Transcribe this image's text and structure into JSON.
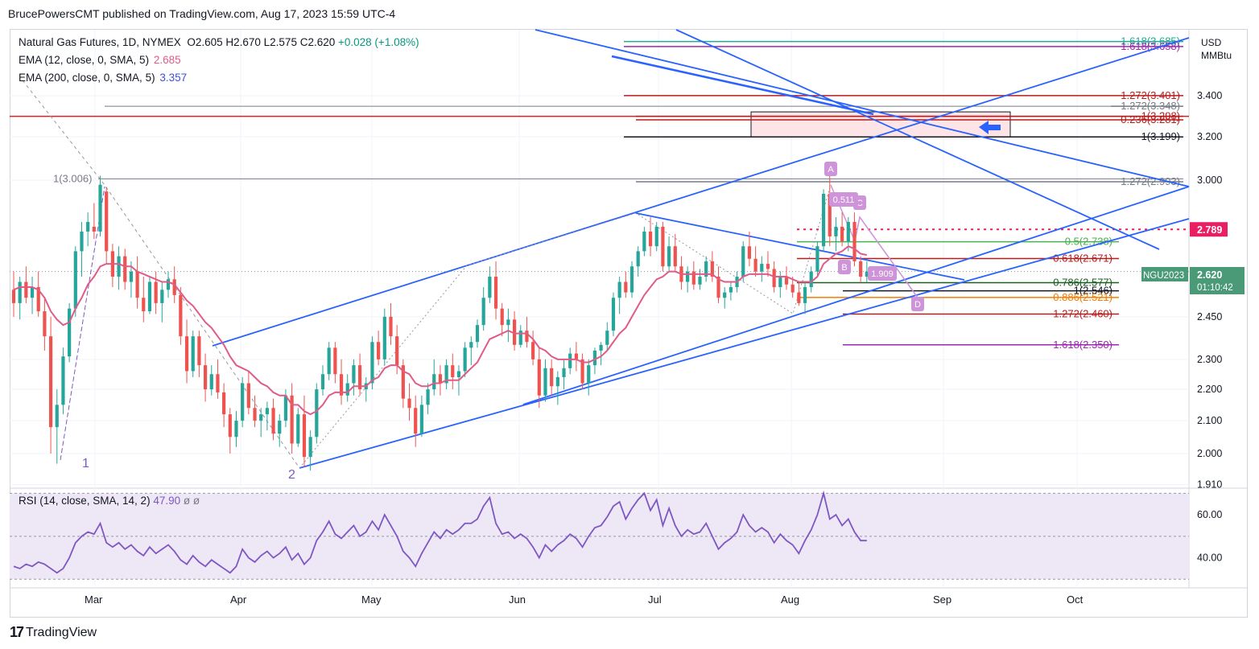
{
  "header": {
    "publisher_line": "BrucePowersCMT published on TradingView.com, Aug 17, 2023 15:59 UTC-4"
  },
  "legend": {
    "symbol": "Natural Gas Futures, 1D, NYMEX",
    "ohlc": "O2.605  H2.670  L2.575  C2.620",
    "change": "+0.028 (+1.08%)",
    "ema12_label": "EMA (12, close, 0, SMA, 5)",
    "ema12_value": "2.685",
    "ema200_label": "EMA (200, close, 0, SMA, 5)",
    "ema200_value": "3.357",
    "rsi_label": "RSI (14, close, SMA, 14, 2)",
    "rsi_value": "47.90",
    "rsi_extra": "ø  ø"
  },
  "currency": {
    "line1": "USD",
    "line2": "MMBtu"
  },
  "colors": {
    "up": "#26a69a",
    "down": "#ef5350",
    "ema12": "#e05b86",
    "ema200": "#3f51d8",
    "trend": "#2962ff",
    "rsi": "#7e57c2",
    "rsi_band": "#ede7f6",
    "price_tag": "#e91e63",
    "last_tag": "#4a9a78"
  },
  "logo": {
    "text": "TradingView"
  },
  "chart_data": {
    "type": "candlestick",
    "title": "Natural Gas Futures, 1D, NYMEX",
    "y_axis": {
      "scale": "log",
      "ticks": [
        "3.400",
        "3.200",
        "3.000",
        "2.450",
        "2.300",
        "2.200",
        "2.100",
        "2.000",
        "1.910"
      ],
      "tick_values": [
        3.4,
        3.2,
        3.0,
        2.45,
        2.3,
        2.2,
        2.1,
        2.0,
        1.91
      ],
      "range": [
        1.9,
        3.75
      ]
    },
    "x_axis": {
      "ticks": [
        "Mar",
        "Apr",
        "May",
        "Jun",
        "Jul",
        "Aug",
        "Sep",
        "Oct"
      ]
    },
    "price_tags": [
      {
        "label": "2.789",
        "value": 2.789,
        "kind": "alert"
      },
      {
        "symbol": "NGU2023",
        "label": "2.620",
        "countdown": "01:10:42",
        "value": 2.62,
        "kind": "last"
      }
    ],
    "candles_ohlc": [
      [
        2.55,
        2.62,
        2.45,
        2.5
      ],
      [
        2.5,
        2.6,
        2.44,
        2.58
      ],
      [
        2.58,
        2.64,
        2.5,
        2.52
      ],
      [
        2.52,
        2.6,
        2.46,
        2.56
      ],
      [
        2.56,
        2.62,
        2.45,
        2.47
      ],
      [
        2.47,
        2.52,
        2.33,
        2.38
      ],
      [
        2.38,
        2.45,
        2.0,
        2.08
      ],
      [
        2.08,
        2.2,
        1.97,
        2.15
      ],
      [
        2.15,
        2.34,
        2.12,
        2.31
      ],
      [
        2.31,
        2.5,
        2.29,
        2.48
      ],
      [
        2.48,
        2.72,
        2.45,
        2.7
      ],
      [
        2.7,
        2.82,
        2.6,
        2.78
      ],
      [
        2.78,
        2.86,
        2.72,
        2.82
      ],
      [
        2.8,
        2.9,
        2.75,
        2.78
      ],
      [
        2.78,
        3.02,
        2.76,
        2.98
      ],
      [
        2.95,
        2.97,
        2.65,
        2.7
      ],
      [
        2.7,
        2.73,
        2.56,
        2.6
      ],
      [
        2.6,
        2.72,
        2.55,
        2.68
      ],
      [
        2.68,
        2.71,
        2.55,
        2.58
      ],
      [
        2.58,
        2.66,
        2.52,
        2.62
      ],
      [
        2.62,
        2.68,
        2.48,
        2.52
      ],
      [
        2.52,
        2.6,
        2.43,
        2.47
      ],
      [
        2.47,
        2.6,
        2.46,
        2.58
      ],
      [
        2.58,
        2.62,
        2.46,
        2.5
      ],
      [
        2.5,
        2.58,
        2.43,
        2.55
      ],
      [
        2.55,
        2.62,
        2.52,
        2.59
      ],
      [
        2.59,
        2.64,
        2.5,
        2.53
      ],
      [
        2.53,
        2.56,
        2.35,
        2.38
      ],
      [
        2.38,
        2.44,
        2.22,
        2.26
      ],
      [
        2.26,
        2.4,
        2.24,
        2.38
      ],
      [
        2.38,
        2.4,
        2.24,
        2.28
      ],
      [
        2.28,
        2.32,
        2.16,
        2.2
      ],
      [
        2.2,
        2.28,
        2.18,
        2.25
      ],
      [
        2.25,
        2.3,
        2.17,
        2.19
      ],
      [
        2.19,
        2.22,
        2.08,
        2.12
      ],
      [
        2.12,
        2.14,
        2.0,
        2.05
      ],
      [
        2.05,
        2.13,
        2.02,
        2.1
      ],
      [
        2.1,
        2.24,
        2.08,
        2.22
      ],
      [
        2.22,
        2.26,
        2.12,
        2.14
      ],
      [
        2.14,
        2.18,
        2.08,
        2.1
      ],
      [
        2.1,
        2.14,
        2.05,
        2.12
      ],
      [
        2.12,
        2.16,
        2.07,
        2.14
      ],
      [
        2.14,
        2.17,
        2.04,
        2.06
      ],
      [
        2.06,
        2.12,
        2.02,
        2.1
      ],
      [
        2.1,
        2.2,
        2.08,
        2.18
      ],
      [
        2.18,
        2.22,
        2.0,
        2.03
      ],
      [
        2.03,
        2.14,
        2.02,
        2.12
      ],
      [
        2.12,
        2.18,
        1.96,
        1.99
      ],
      [
        1.99,
        2.07,
        1.95,
        2.05
      ],
      [
        2.05,
        2.22,
        2.03,
        2.2
      ],
      [
        2.2,
        2.28,
        2.18,
        2.25
      ],
      [
        2.25,
        2.36,
        2.23,
        2.34
      ],
      [
        2.34,
        2.36,
        2.22,
        2.25
      ],
      [
        2.25,
        2.3,
        2.15,
        2.18
      ],
      [
        2.18,
        2.25,
        2.16,
        2.22
      ],
      [
        2.22,
        2.3,
        2.18,
        2.28
      ],
      [
        2.28,
        2.32,
        2.18,
        2.2
      ],
      [
        2.2,
        2.24,
        2.16,
        2.22
      ],
      [
        2.22,
        2.38,
        2.2,
        2.36
      ],
      [
        2.36,
        2.4,
        2.28,
        2.3
      ],
      [
        2.3,
        2.48,
        2.28,
        2.45
      ],
      [
        2.45,
        2.5,
        2.35,
        2.38
      ],
      [
        2.38,
        2.42,
        2.25,
        2.28
      ],
      [
        2.28,
        2.3,
        2.14,
        2.17
      ],
      [
        2.17,
        2.22,
        2.1,
        2.14
      ],
      [
        2.14,
        2.18,
        2.02,
        2.06
      ],
      [
        2.06,
        2.18,
        2.05,
        2.15
      ],
      [
        2.15,
        2.22,
        2.12,
        2.2
      ],
      [
        2.2,
        2.3,
        2.18,
        2.25
      ],
      [
        2.25,
        2.28,
        2.18,
        2.22
      ],
      [
        2.22,
        2.3,
        2.2,
        2.28
      ],
      [
        2.28,
        2.32,
        2.2,
        2.24
      ],
      [
        2.24,
        2.28,
        2.18,
        2.26
      ],
      [
        2.26,
        2.36,
        2.24,
        2.34
      ],
      [
        2.34,
        2.38,
        2.28,
        2.36
      ],
      [
        2.36,
        2.44,
        2.34,
        2.42
      ],
      [
        2.42,
        2.56,
        2.4,
        2.52
      ],
      [
        2.52,
        2.64,
        2.5,
        2.6
      ],
      [
        2.6,
        2.66,
        2.44,
        2.48
      ],
      [
        2.48,
        2.5,
        2.38,
        2.42
      ],
      [
        2.42,
        2.48,
        2.36,
        2.44
      ],
      [
        2.44,
        2.47,
        2.33,
        2.35
      ],
      [
        2.35,
        2.42,
        2.34,
        2.4
      ],
      [
        2.4,
        2.45,
        2.34,
        2.36
      ],
      [
        2.36,
        2.4,
        2.28,
        2.3
      ],
      [
        2.3,
        2.34,
        2.14,
        2.18
      ],
      [
        2.18,
        2.3,
        2.16,
        2.27
      ],
      [
        2.27,
        2.3,
        2.18,
        2.21
      ],
      [
        2.21,
        2.26,
        2.15,
        2.24
      ],
      [
        2.24,
        2.3,
        2.2,
        2.27
      ],
      [
        2.27,
        2.34,
        2.25,
        2.32
      ],
      [
        2.32,
        2.36,
        2.26,
        2.3
      ],
      [
        2.3,
        2.32,
        2.2,
        2.22
      ],
      [
        2.22,
        2.3,
        2.18,
        2.28
      ],
      [
        2.28,
        2.34,
        2.25,
        2.33
      ],
      [
        2.33,
        2.36,
        2.28,
        2.35
      ],
      [
        2.35,
        2.43,
        2.33,
        2.4
      ],
      [
        2.4,
        2.54,
        2.38,
        2.52
      ],
      [
        2.52,
        2.6,
        2.46,
        2.58
      ],
      [
        2.58,
        2.62,
        2.52,
        2.54
      ],
      [
        2.54,
        2.66,
        2.52,
        2.64
      ],
      [
        2.64,
        2.72,
        2.6,
        2.7
      ],
      [
        2.7,
        2.8,
        2.68,
        2.78
      ],
      [
        2.78,
        2.84,
        2.68,
        2.72
      ],
      [
        2.72,
        2.82,
        2.7,
        2.8
      ],
      [
        2.8,
        2.82,
        2.62,
        2.64
      ],
      [
        2.64,
        2.76,
        2.62,
        2.72
      ],
      [
        2.72,
        2.77,
        2.62,
        2.64
      ],
      [
        2.64,
        2.68,
        2.55,
        2.58
      ],
      [
        2.58,
        2.64,
        2.54,
        2.62
      ],
      [
        2.62,
        2.66,
        2.55,
        2.57
      ],
      [
        2.57,
        2.63,
        2.55,
        2.6
      ],
      [
        2.6,
        2.68,
        2.58,
        2.66
      ],
      [
        2.66,
        2.7,
        2.58,
        2.6
      ],
      [
        2.6,
        2.64,
        2.5,
        2.52
      ],
      [
        2.52,
        2.56,
        2.48,
        2.54
      ],
      [
        2.54,
        2.58,
        2.51,
        2.56
      ],
      [
        2.56,
        2.62,
        2.54,
        2.6
      ],
      [
        2.6,
        2.74,
        2.58,
        2.72
      ],
      [
        2.72,
        2.78,
        2.64,
        2.67
      ],
      [
        2.67,
        2.72,
        2.6,
        2.62
      ],
      [
        2.62,
        2.68,
        2.58,
        2.65
      ],
      [
        2.65,
        2.7,
        2.6,
        2.63
      ],
      [
        2.63,
        2.66,
        2.54,
        2.56
      ],
      [
        2.56,
        2.62,
        2.52,
        2.6
      ],
      [
        2.6,
        2.64,
        2.55,
        2.57
      ],
      [
        2.57,
        2.6,
        2.52,
        2.54
      ],
      [
        2.54,
        2.58,
        2.49,
        2.5
      ],
      [
        2.5,
        2.58,
        2.46,
        2.56
      ],
      [
        2.56,
        2.64,
        2.54,
        2.62
      ],
      [
        2.62,
        2.74,
        2.6,
        2.72
      ],
      [
        2.72,
        2.96,
        2.7,
        2.94
      ],
      [
        2.94,
        3.02,
        2.72,
        2.76
      ],
      [
        2.76,
        2.84,
        2.7,
        2.8
      ],
      [
        2.8,
        2.86,
        2.72,
        2.74
      ],
      [
        2.74,
        2.84,
        2.7,
        2.82
      ],
      [
        2.82,
        2.86,
        2.64,
        2.66
      ],
      [
        2.66,
        2.68,
        2.58,
        2.6
      ],
      [
        2.6,
        2.66,
        2.58,
        2.62
      ]
    ],
    "ema12": [
      2.55,
      2.56,
      2.56,
      2.56,
      2.55,
      2.52,
      2.47,
      2.44,
      2.42,
      2.43,
      2.48,
      2.52,
      2.57,
      2.6,
      2.64,
      2.65,
      2.65,
      2.65,
      2.64,
      2.64,
      2.62,
      2.61,
      2.6,
      2.59,
      2.58,
      2.58,
      2.57,
      2.54,
      2.51,
      2.49,
      2.46,
      2.43,
      2.41,
      2.38,
      2.35,
      2.31,
      2.28,
      2.27,
      2.26,
      2.24,
      2.22,
      2.21,
      2.19,
      2.18,
      2.18,
      2.15,
      2.15,
      2.13,
      2.12,
      2.13,
      2.15,
      2.18,
      2.19,
      2.19,
      2.19,
      2.21,
      2.21,
      2.21,
      2.23,
      2.24,
      2.27,
      2.28,
      2.28,
      2.26,
      2.25,
      2.22,
      2.21,
      2.21,
      2.22,
      2.22,
      2.23,
      2.23,
      2.23,
      2.25,
      2.27,
      2.29,
      2.33,
      2.37,
      2.38,
      2.39,
      2.4,
      2.39,
      2.39,
      2.39,
      2.37,
      2.34,
      2.33,
      2.31,
      2.3,
      2.3,
      2.3,
      2.3,
      2.29,
      2.29,
      2.3,
      2.31,
      2.33,
      2.36,
      2.39,
      2.41,
      2.45,
      2.49,
      2.53,
      2.56,
      2.59,
      2.6,
      2.62,
      2.62,
      2.61,
      2.61,
      2.61,
      2.61,
      2.61,
      2.61,
      2.59,
      2.58,
      2.58,
      2.58,
      2.6,
      2.61,
      2.61,
      2.61,
      2.61,
      2.6,
      2.6,
      2.6,
      2.59,
      2.58,
      2.58,
      2.58,
      2.6,
      2.65,
      2.67,
      2.69,
      2.7,
      2.72,
      2.71,
      2.69,
      2.685
    ],
    "rsi": [
      36,
      35,
      37,
      36,
      38,
      37,
      35,
      33,
      35,
      40,
      47,
      50,
      52,
      51,
      56,
      47,
      45,
      47,
      44,
      46,
      43,
      41,
      45,
      42,
      44,
      46,
      43,
      39,
      37,
      41,
      38,
      36,
      39,
      37,
      35,
      33,
      36,
      44,
      40,
      38,
      41,
      43,
      40,
      42,
      45,
      39,
      42,
      37,
      40,
      48,
      52,
      57,
      51,
      49,
      52,
      55,
      50,
      52,
      57,
      53,
      60,
      55,
      50,
      43,
      40,
      36,
      42,
      47,
      52,
      49,
      53,
      51,
      53,
      56,
      56,
      58,
      64,
      68,
      56,
      51,
      52,
      49,
      51,
      49,
      45,
      40,
      46,
      43,
      46,
      48,
      51,
      49,
      45,
      50,
      54,
      55,
      59,
      64,
      66,
      58,
      63,
      67,
      70,
      62,
      67,
      55,
      63,
      55,
      50,
      53,
      51,
      52,
      56,
      50,
      44,
      47,
      49,
      52,
      60,
      55,
      52,
      54,
      52,
      47,
      51,
      48,
      46,
      42,
      48,
      53,
      60,
      70,
      58,
      60,
      55,
      58,
      52,
      48,
      48
    ],
    "rsi_axis": {
      "ticks": [
        "60.00",
        "40.00"
      ],
      "tick_values": [
        60,
        40
      ],
      "range": [
        26,
        72
      ],
      "band": [
        30,
        70
      ],
      "midline": 50
    },
    "fib_levels": [
      {
        "label": "1.618(3.685)",
        "value": 3.685,
        "color": "#22ab94"
      },
      {
        "label": "1.618(3.658)",
        "value": 3.658,
        "color": "#9c27b0"
      },
      {
        "label": "1.272(3.401)",
        "value": 3.401,
        "color": "#b71c1c"
      },
      {
        "label": "1.272(3.348)",
        "value": 3.348,
        "color": "#787b86"
      },
      {
        "label": "1(3.298)",
        "value": 3.298,
        "color": "#b71c1c"
      },
      {
        "label": "0.236(3.281)",
        "value": 3.281,
        "color": "#b71c1c"
      },
      {
        "label": "1(3.199)",
        "value": 3.199,
        "color": "#131722"
      },
      {
        "label": "1.272(2.993)",
        "value": 2.993,
        "color": "#787b86"
      },
      {
        "label": "1(3.006)",
        "value": 3.006,
        "color": "#787b86"
      },
      {
        "label": "0.5(2.738)",
        "value": 2.738,
        "color": "#4caf50"
      },
      {
        "label": "0.618(2.671)",
        "value": 2.671,
        "color": "#b71c1c"
      },
      {
        "label": "0.786(2.577)",
        "value": 2.577,
        "color": "#1b5e20"
      },
      {
        "label": "1(2.546)",
        "value": 2.546,
        "color": "#131722"
      },
      {
        "label": "0.886(2.521)",
        "value": 2.521,
        "color": "#f57c00"
      },
      {
        "label": "1.272(2.460)",
        "value": 2.46,
        "color": "#b71c1c"
      },
      {
        "label": "1.618(2.350)",
        "value": 2.35,
        "color": "#9c27b0"
      }
    ],
    "wave_labels": [
      "1",
      "2"
    ],
    "harmonic_labels": [
      "A",
      "B",
      "C",
      "D"
    ],
    "harmonic_ratio_labels": [
      "0.511",
      "1.909"
    ],
    "grid": true
  }
}
